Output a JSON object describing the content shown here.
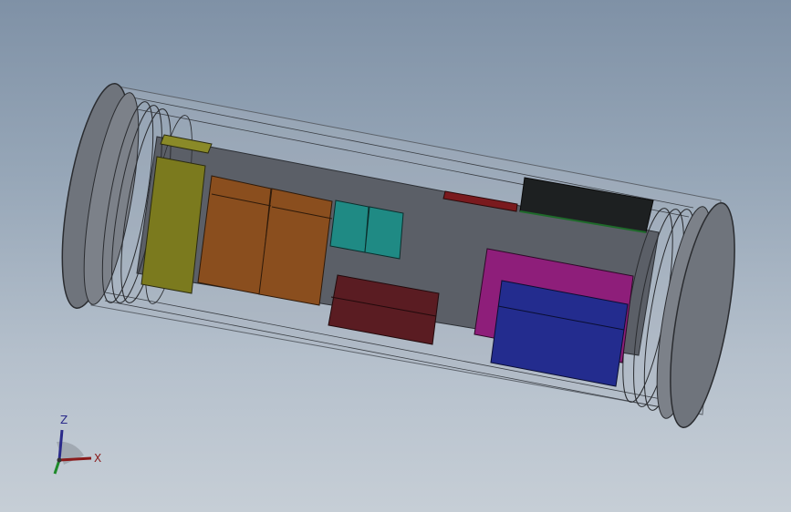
{
  "scene": {
    "background_top": "#7f91a6",
    "background_bottom": "#c6ced6",
    "housing_color": "#8f949c",
    "endcap_color": "#6f747c",
    "chassis_color": "#5b5f67"
  },
  "components": [
    {
      "name": "yellow-module",
      "color": "#7b7a1e"
    },
    {
      "name": "brown-module-left",
      "color": "#8a4e1e"
    },
    {
      "name": "brown-module-right",
      "color": "#8a4e1e"
    },
    {
      "name": "teal-module-left",
      "color": "#1f8a84"
    },
    {
      "name": "teal-module-right",
      "color": "#1f8a84"
    },
    {
      "name": "dark-red-module",
      "color": "#5a1c22"
    },
    {
      "name": "magenta-module",
      "color": "#8e1e7a"
    },
    {
      "name": "blue-module",
      "color": "#232c8e"
    },
    {
      "name": "black-board",
      "color": "#1d2021"
    },
    {
      "name": "red-connector",
      "color": "#7a1a1e"
    }
  ],
  "triad": {
    "z_label": "Z",
    "x_label": "X",
    "z_color": "#2a2a8a",
    "x_color": "#8a1a1a",
    "y_color": "#1e8a2a"
  }
}
